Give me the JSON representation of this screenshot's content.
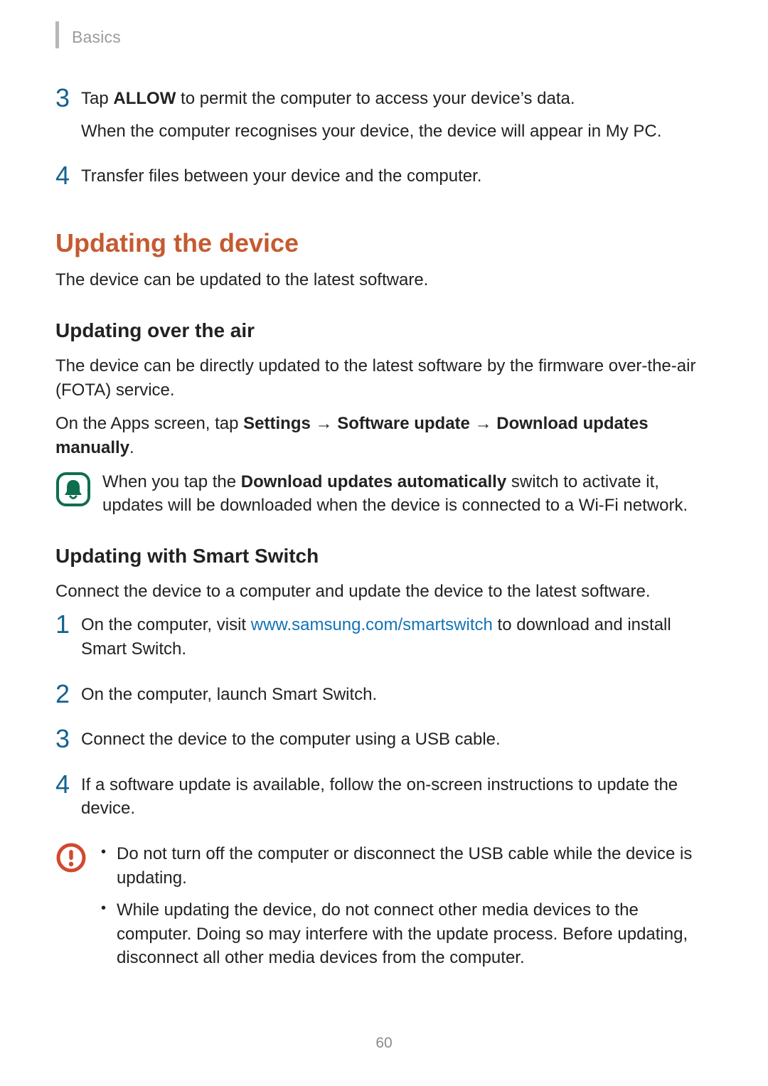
{
  "header": {
    "section": "Basics"
  },
  "continued_steps": {
    "step3": {
      "num": "3",
      "line1_prefix": "Tap ",
      "line1_bold": "ALLOW",
      "line1_suffix": " to permit the computer to access your device’s data.",
      "line2": "When the computer recognises your device, the device will appear in My PC."
    },
    "step4": {
      "num": "4",
      "text": "Transfer files between your device and the computer."
    }
  },
  "section1": {
    "title": "Updating the device",
    "intro": "The device can be updated to the latest software."
  },
  "ota": {
    "title": "Updating over the air",
    "intro": "The device can be directly updated to the latest software by the firmware over-the-air (FOTA) service.",
    "path_prefix": "On the Apps screen, tap ",
    "path_b1": "Settings",
    "arrow": " → ",
    "path_b2": "Software update",
    "path_b3": "Download updates manually",
    "path_suffix": ".",
    "note_prefix": "When you tap the ",
    "note_bold": "Download updates automatically",
    "note_suffix": " switch to activate it, updates will be downloaded when the device is connected to a Wi-Fi network."
  },
  "smartswitch": {
    "title": "Updating with Smart Switch",
    "intro": "Connect the device to a computer and update the device to the latest software.",
    "steps": {
      "s1": {
        "num": "1",
        "pre": "On the computer, visit ",
        "link_text": "www.samsung.com/smartswitch",
        "link_href": "http://www.samsung.com/smartswitch",
        "post": " to download and install Smart Switch."
      },
      "s2": {
        "num": "2",
        "text": "On the computer, launch Smart Switch."
      },
      "s3": {
        "num": "3",
        "text": "Connect the device to the computer using a USB cable."
      },
      "s4": {
        "num": "4",
        "text": "If a software update is available, follow the on-screen instructions to update the device."
      }
    },
    "caution": {
      "b1": "Do not turn off the computer or disconnect the USB cable while the device is updating.",
      "b2": "While updating the device, do not connect other media devices to the computer. Doing so may interfere with the update process. Before updating, disconnect all other media devices from the computer."
    }
  },
  "page_number": "60"
}
